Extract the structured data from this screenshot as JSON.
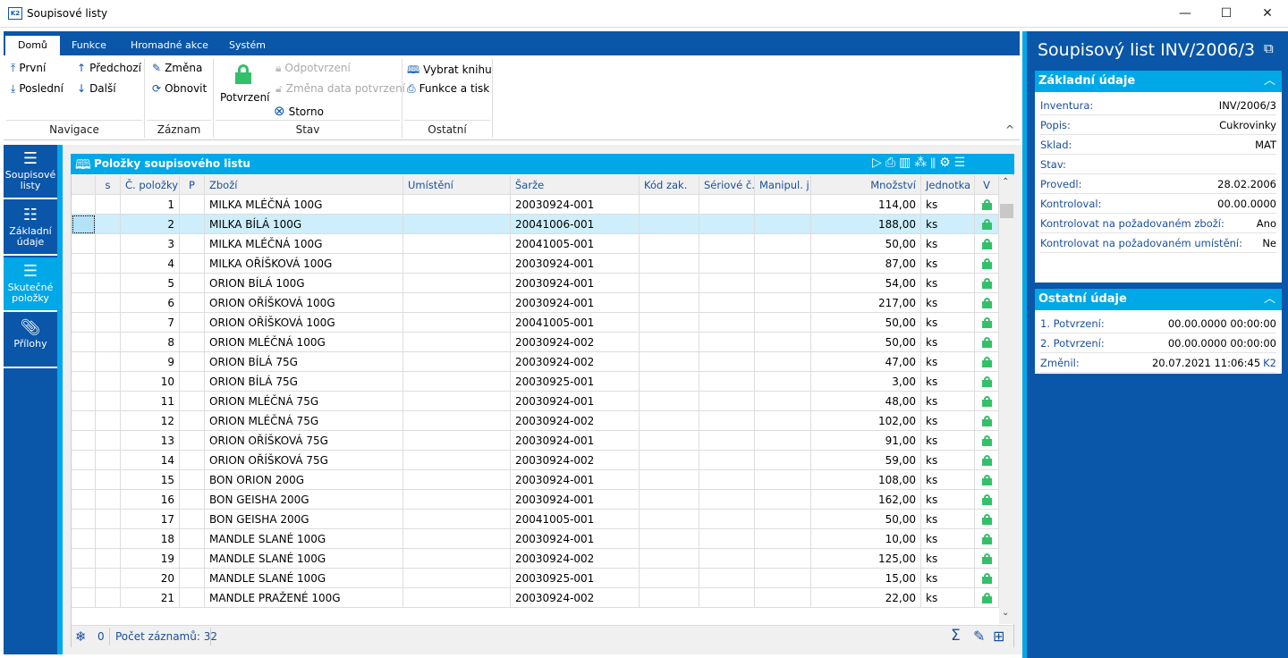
{
  "window": {
    "title": "Soupisové listy",
    "logo": "K2",
    "minimize": "—",
    "maximize": "☐",
    "close": "✕"
  },
  "ribbon": {
    "tabs": [
      "Domů",
      "Funkce",
      "Hromadné akce",
      "Systém"
    ],
    "navigace": {
      "label": "Navigace",
      "first": "První",
      "last": "Poslední",
      "prev": "Předchozí",
      "next": "Další"
    },
    "zaznam": {
      "label": "Záznam",
      "edit": "Změna",
      "refresh": "Obnovit"
    },
    "stav": {
      "label": "Stav",
      "confirm": "Potvrzení",
      "unconfirm": "Odpotvrzení",
      "change_date": "Změna data potvrzení",
      "storno": "Storno"
    },
    "ostatni": {
      "label": "Ostatní",
      "book": "Vybrat knihu",
      "print": "Funkce a tisk"
    },
    "collapse": "^"
  },
  "leftnav": [
    {
      "label": "Soupisové listy",
      "icon": "hamburger-icon"
    },
    {
      "label": "Základní údaje",
      "icon": "list-icon"
    },
    {
      "label": "Skutečné položky",
      "icon": "hamburger-icon",
      "active": true
    },
    {
      "label": "Přílohy",
      "icon": "paperclip-icon"
    }
  ],
  "grid": {
    "title": "Položky soupisového listu",
    "columns": [
      "",
      "s",
      "Č. položky",
      "P",
      "Zboží",
      "Umístění",
      "Šarže",
      "Kód zak.",
      "Sériové č.",
      "Manipul. j.",
      "Množství",
      "Jednotka",
      "V"
    ],
    "selected_row": 2,
    "rows": [
      [
        "1",
        "MILKA MLÉČNÁ 100G",
        "20030924-001",
        "114,00",
        "ks"
      ],
      [
        "2",
        "MILKA BÍLÁ 100G",
        "20041006-001",
        "188,00",
        "ks"
      ],
      [
        "3",
        "MILKA MLÉČNÁ 100G",
        "20041005-001",
        "50,00",
        "ks"
      ],
      [
        "4",
        "MILKA OŘÍŠKOVÁ 100G",
        "20030924-001",
        "87,00",
        "ks"
      ],
      [
        "5",
        "ORION BÍLÁ 100G",
        "20030924-001",
        "54,00",
        "ks"
      ],
      [
        "6",
        "ORION OŘÍŠKOVÁ 100G",
        "20030924-001",
        "217,00",
        "ks"
      ],
      [
        "7",
        "ORION OŘÍŠKOVÁ 100G",
        "20041005-001",
        "50,00",
        "ks"
      ],
      [
        "8",
        "ORION MLÉČNÁ 100G",
        "20030924-002",
        "50,00",
        "ks"
      ],
      [
        "9",
        "ORION BÍLÁ 75G",
        "20030924-002",
        "47,00",
        "ks"
      ],
      [
        "10",
        "ORION BÍLÁ 75G",
        "20030925-001",
        "3,00",
        "ks"
      ],
      [
        "11",
        "ORION MLÉČNÁ 75G",
        "20030924-001",
        "48,00",
        "ks"
      ],
      [
        "12",
        "ORION MLÉČNÁ 75G",
        "20030924-002",
        "102,00",
        "ks"
      ],
      [
        "13",
        "ORION OŘÍŠKOVÁ 75G",
        "20030924-001",
        "91,00",
        "ks"
      ],
      [
        "14",
        "ORION OŘÍŠKOVÁ 75G",
        "20030924-002",
        "59,00",
        "ks"
      ],
      [
        "15",
        "BON ORION 200G",
        "20030924-001",
        "108,00",
        "ks"
      ],
      [
        "16",
        "BON GEISHA 200G",
        "20030924-001",
        "162,00",
        "ks"
      ],
      [
        "17",
        "BON GEISHA 200G",
        "20041005-001",
        "50,00",
        "ks"
      ],
      [
        "18",
        "MANDLE SLANÉ  100G",
        "20030924-001",
        "10,00",
        "ks"
      ],
      [
        "19",
        "MANDLE SLANÉ  100G",
        "20030924-002",
        "125,00",
        "ks"
      ],
      [
        "20",
        "MANDLE SLANÉ  100G",
        "20030925-001",
        "15,00",
        "ks"
      ],
      [
        "21",
        "MANDLE PRAŽENÉ  100G",
        "20030924-002",
        "22,00",
        "ks"
      ]
    ],
    "status": {
      "filter_count": "0",
      "records": "Počet záznamů: 32"
    }
  },
  "detail": {
    "title": "Soupisový list INV/2006/3",
    "basic": {
      "label": "Základní údaje",
      "fields": [
        [
          "Inventura:",
          "INV/2006/3"
        ],
        [
          "Popis:",
          "Cukrovinky"
        ],
        [
          "Sklad:",
          "MAT"
        ],
        [
          "Stav:",
          ""
        ],
        [
          "Provedl:",
          "28.02.2006"
        ],
        [
          "Kontroloval:",
          "00.00.0000"
        ],
        [
          "Kontrolovat na požadovaném zboží:",
          "Ano"
        ],
        [
          "Kontrolovat na požadovaném umístění:",
          "Ne"
        ]
      ]
    },
    "other": {
      "label": "Ostatní údaje",
      "fields": [
        [
          "1. Potvrzení:",
          "00.00.0000 00:00:00"
        ],
        [
          "2. Potvrzení:",
          "00.00.0000 00:00:00"
        ],
        [
          "Změnil:",
          "20.07.2021 11:06:45"
        ]
      ],
      "changed_by": "K2"
    }
  },
  "colors": {
    "dark_blue": "#0a56a8",
    "accent": "#00a8e8",
    "lock": "#34c06a",
    "selected_row": "#cdeefa"
  }
}
